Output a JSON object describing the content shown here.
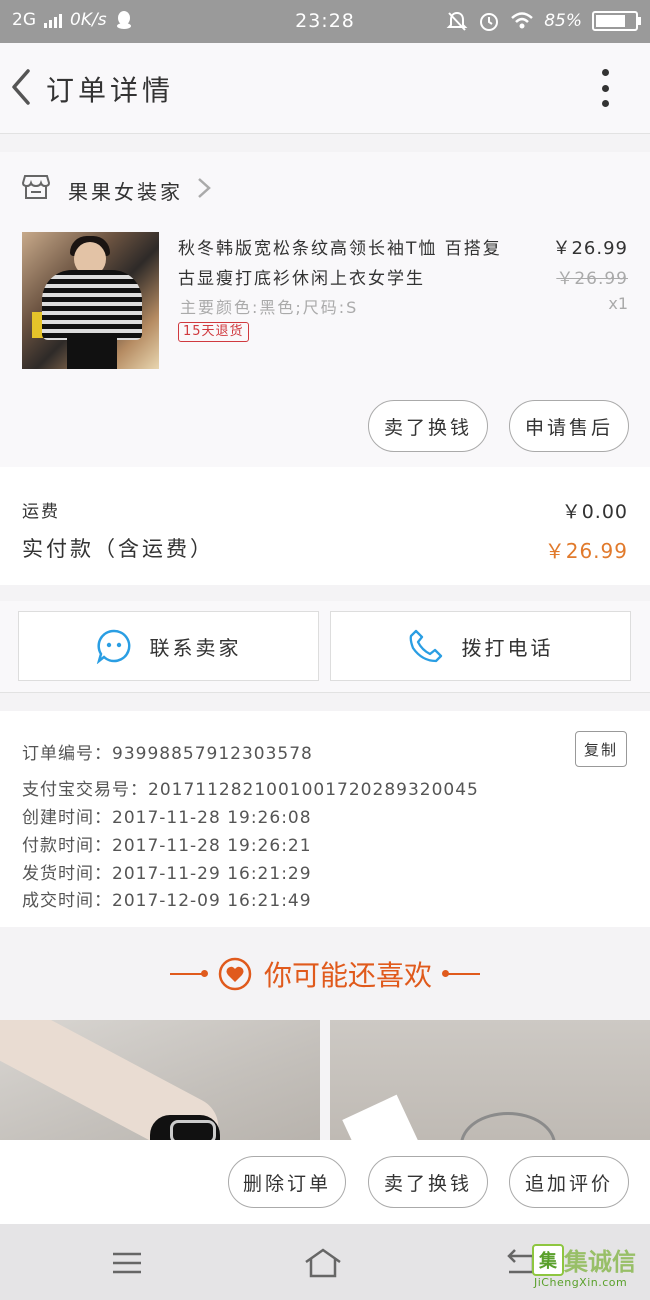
{
  "status": {
    "network": "2G",
    "speed": "0K/s",
    "time": "23:28",
    "battery": "85%",
    "battery_level": 0.85
  },
  "header": {
    "title": "订单详情"
  },
  "shop": {
    "name": "果果女装家"
  },
  "product": {
    "title": "秋冬韩版宽松条纹高领长袖T恤 百搭复古显瘦打底衫休闲上衣女学生",
    "price": "￥26.99",
    "original_price": "￥26.99",
    "quantity": "x1",
    "spec": "主要颜色:黑色;尺码:S",
    "tag": "15天退货",
    "buttons": {
      "sold_swap": "卖了换钱",
      "after_sale": "申请售后"
    }
  },
  "fee": {
    "shipping_label": "运费",
    "shipping_value": "￥0.00",
    "paid_label": "实付款（含运费）",
    "paid_value": "￥26.99"
  },
  "contact": {
    "seller": "联系卖家",
    "phone": "拨打电话"
  },
  "order_info": {
    "order_no": "订单编号：93998857912303578",
    "alipay_no": "支付宝交易号：2017112821001001720289320045",
    "created": "创建时间：2017-11-28  19:26:08",
    "paid": "付款时间：2017-11-28  19:26:21",
    "shipped": "发货时间：2017-11-29  16:21:29",
    "completed": "成交时间：2017-12-09  16:21:49",
    "copy_label": "复制"
  },
  "recommend": {
    "title": "你可能还喜欢"
  },
  "actions": {
    "delete": "删除订单",
    "sold_swap": "卖了换钱",
    "add_review": "追加评价"
  },
  "watermark": {
    "brand": "集诚信",
    "url": "JiChengXin.com"
  },
  "colors": {
    "accent_orange": "#e17a2c",
    "tag_red": "#d0393e",
    "contact_blue": "#2a9ee3"
  }
}
